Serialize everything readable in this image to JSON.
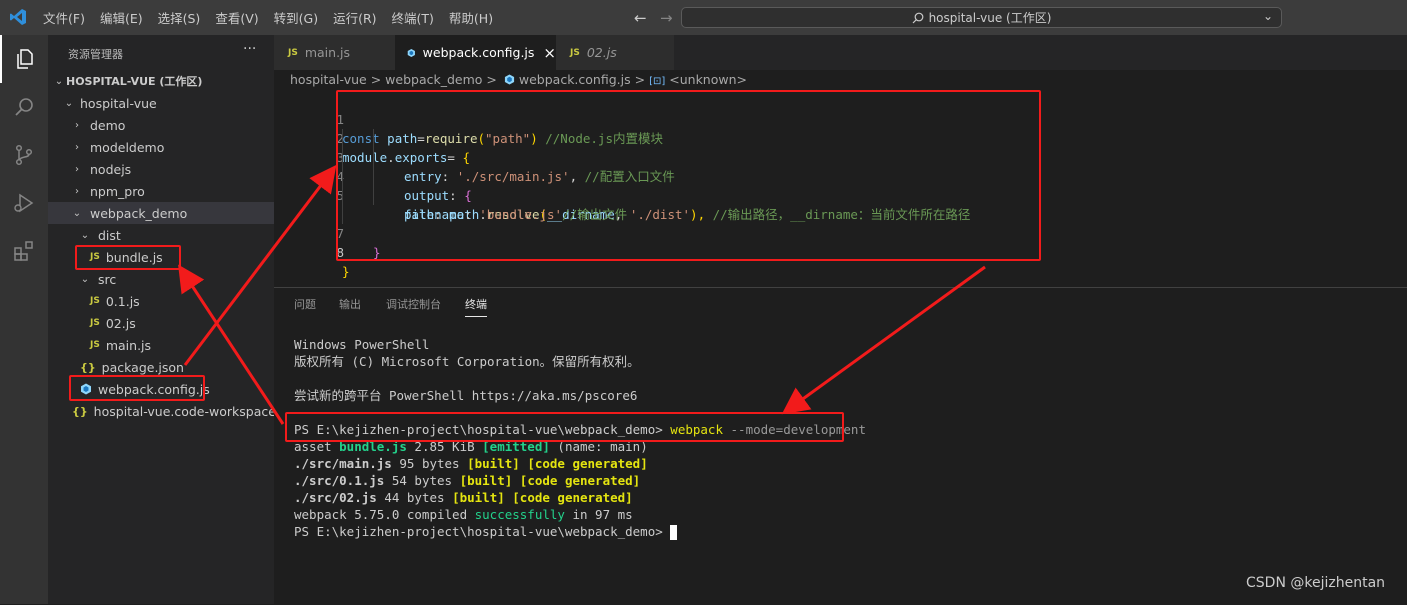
{
  "menu": [
    "文件(F)",
    "编辑(E)",
    "选择(S)",
    "查看(V)",
    "转到(G)",
    "运行(R)",
    "终端(T)",
    "帮助(H)"
  ],
  "command_center": "hospital-vue (工作区)",
  "sidebar": {
    "title": "资源管理器",
    "more": "···",
    "workspace": "HOSPITAL-VUE (工作区)",
    "tree": [
      {
        "label": "hospital-vue",
        "twisty": "⌄"
      },
      {
        "label": "demo",
        "twisty": "›"
      },
      {
        "label": "modeldemo",
        "twisty": "›"
      },
      {
        "label": "nodejs",
        "twisty": "›"
      },
      {
        "label": "npm_pro",
        "twisty": "›"
      },
      {
        "label": "webpack_demo",
        "twisty": "⌄"
      },
      {
        "label": "dist",
        "twisty": "⌄"
      },
      {
        "label": "bundle.js",
        "icon": "JS"
      },
      {
        "label": "src",
        "twisty": "⌄"
      },
      {
        "label": "0.1.js",
        "icon": "JS"
      },
      {
        "label": "02.js",
        "icon": "JS"
      },
      {
        "label": "main.js",
        "icon": "JS"
      },
      {
        "label": "package.json",
        "icon": "{}"
      },
      {
        "label": "webpack.config.js",
        "icon": "webpack-icon"
      },
      {
        "label": "hospital-vue.code-workspace",
        "icon": "{}"
      }
    ]
  },
  "tabs": [
    {
      "label": "main.js",
      "icon": "JS"
    },
    {
      "label": "webpack.config.js",
      "close": "×"
    },
    {
      "label": "02.js",
      "icon": "JS"
    }
  ],
  "breadcrumb": {
    "p1": "hospital-vue",
    "p2": "webpack_demo",
    "p3": "webpack.config.js",
    "p4": "<unknown>",
    "sep": ">"
  },
  "code": {
    "line_numbers": [
      "1",
      "2",
      "3",
      "4",
      "5",
      "7",
      "8"
    ],
    "l1": {
      "a": "const",
      "b": "path",
      "c": "=",
      "d": "require",
      "e": "(",
      "f": "\"path\"",
      "g": ")",
      "h": "//Node.js内置模块"
    },
    "l2": {
      "a": "module",
      "b": ".",
      "c": "exports",
      "d": "= ",
      "e": "{"
    },
    "l3": {
      "a": "entry",
      "b": ": ",
      "c": "'./src/main.js'",
      "d": ", ",
      "e": "//配置入口文件"
    },
    "l4": {
      "a": "output",
      "b": ": ",
      "c": "{"
    },
    "l5": {
      "a": "path",
      "b": ": ",
      "c": "path",
      "d": ".",
      "e": "resolve",
      "f": "(",
      "g": "__dirname",
      "h": ", ",
      "i": "'./dist'",
      "j": "), ",
      "k": "//输出路径，__dirname：当前文件所在路径"
    },
    "l6": {
      "a": "filename",
      "b": ": ",
      "c": "'bundle.js'",
      "d": "//输出文件"
    },
    "l7": "}",
    "l8": "}"
  },
  "panel": {
    "tabs": [
      "问题",
      "输出",
      "调试控制台",
      "终端"
    ]
  },
  "terminal": {
    "l1": "Windows PowerShell",
    "l2": "版权所有 (C) Microsoft Corporation。保留所有权利。",
    "l3": "尝试新的跨平台 PowerShell https://aka.ms/pscore6",
    "prompt": "PS E:\\kejizhen-project\\hospital-vue\\webpack_demo>",
    "cmd": "webpack",
    "args": "--mode=development",
    "asset": {
      "a": "asset ",
      "b": "bundle.js",
      "c": " 2.85 KiB ",
      "d": "[emitted]",
      "e": " (name: main)"
    },
    "mods": [
      {
        "a": "./src/main.js",
        "b": " 95 bytes ",
        "c": "[built]",
        "d": " ",
        "e": "[code generated]"
      },
      {
        "a": "./src/0.1.js",
        "b": " 54 bytes ",
        "c": "[built]",
        "d": " ",
        "e": "[code generated]"
      },
      {
        "a": "./src/02.js",
        "b": " 44 bytes ",
        "c": "[built]",
        "d": " ",
        "e": "[code generated]"
      }
    ],
    "compiled": {
      "a": "webpack 5.75.0 compiled ",
      "b": "successfully",
      "c": " in 97 ms"
    },
    "prompt2": "PS E:\\kejizhen-project\\hospital-vue\\webpack_demo>"
  },
  "watermark": "CSDN @kejizhentan",
  "colors": {
    "annotation": "#f21b1b",
    "accent": "#007acc"
  }
}
